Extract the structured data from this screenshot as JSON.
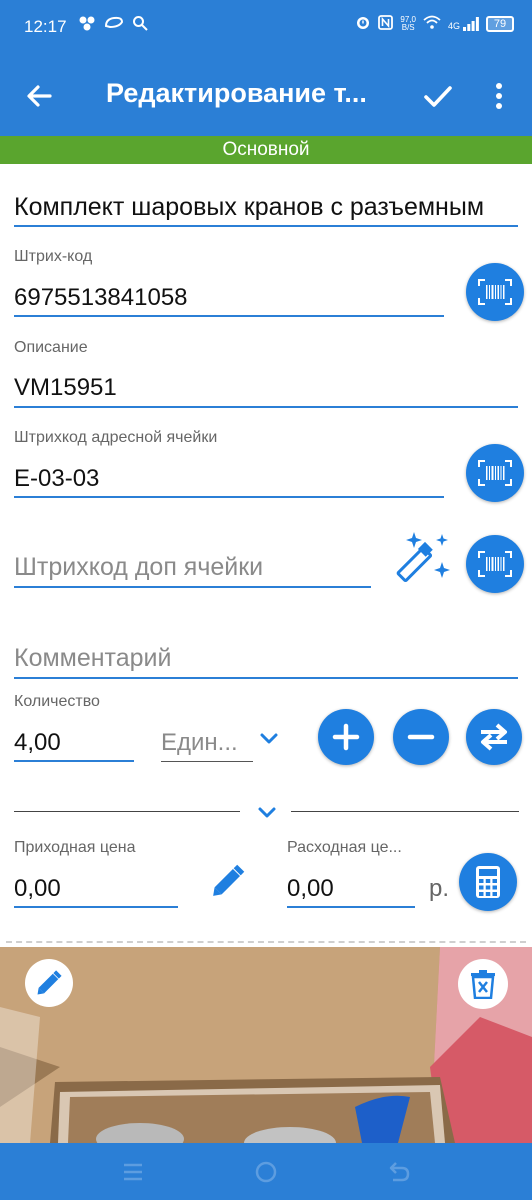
{
  "status_bar": {
    "time": "12:17",
    "network_speed_value": "97,0",
    "network_speed_unit": "B/S",
    "signal_type": "4G",
    "battery": "79",
    "icons_left": [
      "people-icon",
      "cloud-icon",
      "search-icon"
    ],
    "icons_right": [
      "alarm-icon",
      "nfc-icon",
      "wifi-icon",
      "signal-icon",
      "battery-icon"
    ]
  },
  "toolbar": {
    "title": "Редактирование т...",
    "back_icon": "arrow-left-icon",
    "confirm_icon": "check-icon",
    "menu_icon": "more-vertical-icon"
  },
  "tab": {
    "label": "Основной"
  },
  "form": {
    "name": {
      "value": "Комплект шаровых кранов с разъемным"
    },
    "barcode": {
      "label": "Штрих-код",
      "value": "6975513841058",
      "scan_icon": "barcode-scan-icon"
    },
    "description": {
      "label": "Описание",
      "value": "VM15951"
    },
    "cell_barcode": {
      "label": "Штрихкод адресной ячейки",
      "value": "E-03-03",
      "scan_icon": "barcode-scan-icon"
    },
    "extra_cell_barcode": {
      "placeholder": "Штрихкод доп ячейки",
      "generate_icon": "magic-wand-icon",
      "scan_icon": "barcode-scan-icon"
    },
    "comment": {
      "placeholder": "Комментарий"
    },
    "quantity": {
      "label": "Количество",
      "value": "4,00",
      "unit_selected": "Един...",
      "buttons": [
        "plus-icon",
        "minus-icon",
        "swap-icon"
      ]
    },
    "income_price": {
      "label": "Приходная цена",
      "value": "0,00",
      "edit_icon": "pencil-icon"
    },
    "outcome_price": {
      "label": "Расходная це...",
      "value": "0,00",
      "currency": "р.",
      "calc_icon": "calculator-icon"
    }
  },
  "photo": {
    "edit_icon": "pencil-icon",
    "delete_icon": "trash-icon"
  },
  "nav_bar": {
    "buttons": [
      "menu-icon",
      "home-icon",
      "back-icon"
    ]
  },
  "colors": {
    "primary": "#2b7fd6",
    "tab_green": "#5aa52e",
    "button_blue": "#1f7fe0"
  }
}
